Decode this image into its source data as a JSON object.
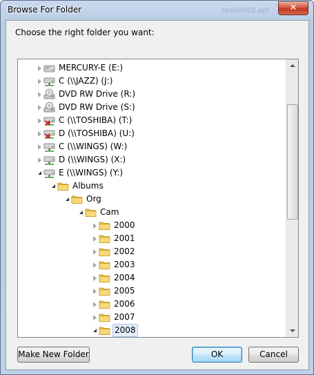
{
  "window": {
    "title": "Browse For Folder",
    "ghost_text": "seetiolt02.ppt"
  },
  "titlebar": {
    "close_glyph": "✕"
  },
  "dialog": {
    "prompt": "Choose the right folder you want:"
  },
  "tree": {
    "items": [
      {
        "label": "MERCURY-E (E:)",
        "icon": "disk-drive-icon",
        "expander": "collapsed",
        "level": 0
      },
      {
        "label": "C (\\\\JAZZ) (J:)",
        "icon": "network-drive-icon",
        "expander": "collapsed",
        "level": 0
      },
      {
        "label": "DVD RW Drive (R:)",
        "icon": "dvd-drive-icon",
        "expander": "collapsed",
        "level": 0
      },
      {
        "label": "DVD RW Drive (S:)",
        "icon": "dvd-drive-icon",
        "expander": "collapsed",
        "level": 0
      },
      {
        "label": "C (\\\\TOSHIBA) (T:)",
        "icon": "disconnected-network-drive-icon",
        "expander": "collapsed",
        "level": 0
      },
      {
        "label": "D (\\\\TOSHIBA) (U:)",
        "icon": "disconnected-network-drive-icon",
        "expander": "collapsed",
        "level": 0
      },
      {
        "label": "C (\\\\WINGS) (W:)",
        "icon": "network-drive-icon",
        "expander": "collapsed",
        "level": 0
      },
      {
        "label": "D (\\\\WINGS) (X:)",
        "icon": "network-drive-icon",
        "expander": "collapsed",
        "level": 0
      },
      {
        "label": "E (\\\\WINGS) (Y:)",
        "icon": "network-drive-icon",
        "expander": "expanded",
        "level": 0
      },
      {
        "label": "Albums",
        "icon": "folder-icon",
        "expander": "expanded",
        "level": 1
      },
      {
        "label": "Org",
        "icon": "folder-icon",
        "expander": "expanded",
        "level": 2
      },
      {
        "label": "Cam",
        "icon": "folder-icon",
        "expander": "expanded",
        "level": 3
      },
      {
        "label": "2000",
        "icon": "folder-icon",
        "expander": "collapsed",
        "level": 4
      },
      {
        "label": "2001",
        "icon": "folder-icon",
        "expander": "collapsed",
        "level": 4
      },
      {
        "label": "2002",
        "icon": "folder-icon",
        "expander": "collapsed",
        "level": 4
      },
      {
        "label": "2003",
        "icon": "folder-icon",
        "expander": "collapsed",
        "level": 4
      },
      {
        "label": "2004",
        "icon": "folder-icon",
        "expander": "collapsed",
        "level": 4
      },
      {
        "label": "2005",
        "icon": "folder-icon",
        "expander": "collapsed",
        "level": 4
      },
      {
        "label": "2006",
        "icon": "folder-icon",
        "expander": "collapsed",
        "level": 4
      },
      {
        "label": "2007",
        "icon": "folder-icon",
        "expander": "collapsed",
        "level": 4
      },
      {
        "label": "2008",
        "icon": "folder-icon",
        "expander": "expanded",
        "level": 4,
        "selected": true
      }
    ]
  },
  "buttons": {
    "make_new_folder": "Make New Folder",
    "ok": "OK",
    "cancel": "Cancel"
  },
  "colors": {
    "selection_bg": "#e5eefb",
    "selection_border": "#a6c3e8",
    "close_red": "#c1381f",
    "window_frame": "#bcd0e8"
  }
}
